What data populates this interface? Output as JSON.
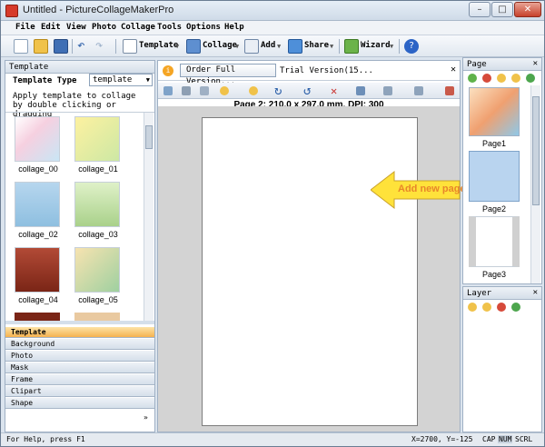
{
  "window": {
    "title": "Untitled - PictureCollageMakerPro"
  },
  "menu": [
    "File",
    "Edit",
    "View",
    "Photo",
    "Collage",
    "Tools",
    "Options",
    "Help"
  ],
  "toolbar": {
    "template_label": "Template",
    "collage_label": "Collage",
    "add_label": "Add",
    "share_label": "Share",
    "wizard_label": "Wizard"
  },
  "template_panel": {
    "title": "Template",
    "type_label": "Template Type",
    "type_value": "template",
    "hint": "Apply template to collage by double clicking or dragging",
    "thumbs": [
      "collage_00",
      "collage_01",
      "collage_02",
      "collage_03",
      "collage_04",
      "collage_05"
    ]
  },
  "categories": [
    "Template",
    "Background",
    "Photo",
    "Mask",
    "Frame",
    "Clipart",
    "Shape"
  ],
  "notice": {
    "button_label": "Order Full Version...",
    "text": "Trial Version(15..."
  },
  "page_info": "Page 2: 210.0 x 297.0 mm, DPI: 300",
  "callout": "Add new page",
  "page_panel": {
    "title": "Page",
    "pages": [
      "Page1",
      "Page2",
      "Page3"
    ]
  },
  "layer_panel": {
    "title": "Layer"
  },
  "status": {
    "help": "For Help, press F1",
    "coords": "X=2700, Y=-125",
    "cap": "CAP",
    "num": "NUM",
    "scrl": "SCRL"
  },
  "colors": {
    "accent": "#f5b24f",
    "callout": "#ffe23a",
    "callout_text": "#e8862a"
  }
}
